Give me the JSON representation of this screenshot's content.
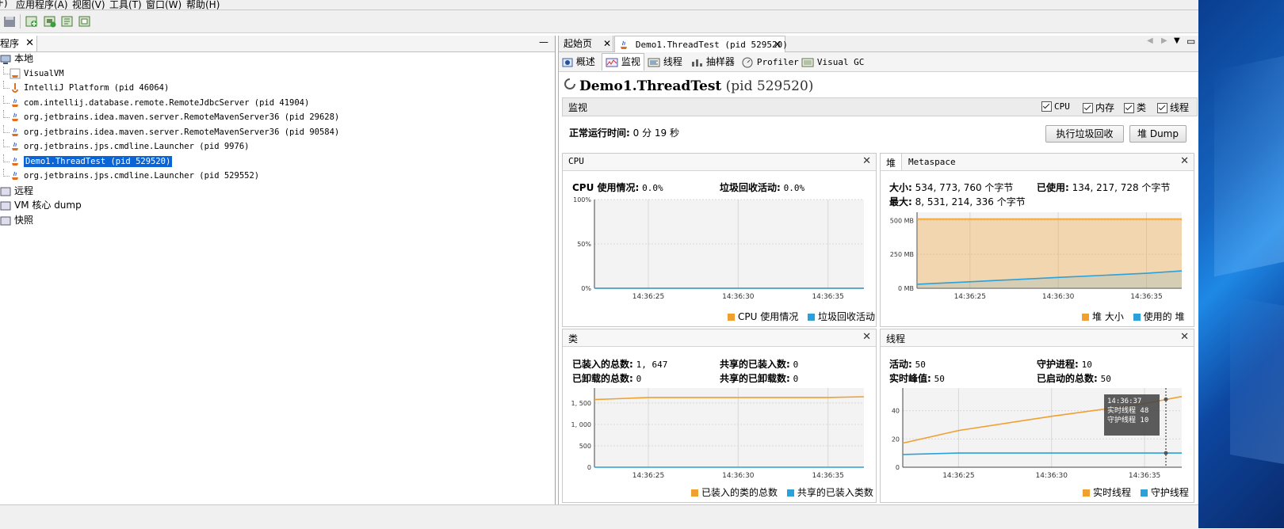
{
  "menu": [
    "F)",
    "应用程序(A)",
    "视图(V)",
    "工具(T)",
    "窗口(W)",
    "帮助(H)"
  ],
  "left": {
    "tab_label": "程序",
    "minimize": "—",
    "tree": [
      {
        "label": "本地",
        "level": 0,
        "icon": "computer-icon"
      },
      {
        "label": "VisualVM",
        "level": 1,
        "icon": "visualvm-icon"
      },
      {
        "label": "IntelliJ Platform (pid 46064)",
        "level": 1,
        "icon": "intellij-icon"
      },
      {
        "label": "com.intellij.database.remote.RemoteJdbcServer (pid 41904)",
        "level": 1,
        "icon": "java-icon"
      },
      {
        "label": "org.jetbrains.idea.maven.server.RemoteMavenServer36 (pid 29628)",
        "level": 1,
        "icon": "java-icon"
      },
      {
        "label": "org.jetbrains.idea.maven.server.RemoteMavenServer36 (pid 90584)",
        "level": 1,
        "icon": "java-icon"
      },
      {
        "label": "org.jetbrains.jps.cmdline.Launcher (pid 9976)",
        "level": 1,
        "icon": "java-icon"
      },
      {
        "label": "Demo1.ThreadTest (pid 529520)",
        "level": 1,
        "icon": "java-icon",
        "selected": true
      },
      {
        "label": "org.jetbrains.jps.cmdline.Launcher (pid 529552)",
        "level": 1,
        "icon": "java-icon"
      },
      {
        "label": "远程",
        "level": 0,
        "icon": "remote-icon"
      },
      {
        "label": "VM 核心 dump",
        "level": 0,
        "icon": "dump-icon"
      },
      {
        "label": "快照",
        "level": 0,
        "icon": "snapshot-icon"
      }
    ]
  },
  "doc_tabs": [
    {
      "label": "起始页"
    },
    {
      "label": "Demo1.ThreadTest (pid 529520)"
    }
  ],
  "sub_tabs": [
    "概述",
    "监视",
    "线程",
    "抽样器",
    "Profiler",
    "Visual GC"
  ],
  "app_title": "Demo1.ThreadTest",
  "app_pid": "(pid 529520)",
  "monitor": {
    "section_label": "监视",
    "checks": [
      "CPU",
      "内存",
      "类",
      "线程"
    ],
    "uptime_label": "正常运行时间:",
    "uptime_value": "0 分 19 秒",
    "gc_button": "执行垃圾回收",
    "heap_dump_button": "堆 Dump"
  },
  "cpu_panel": {
    "title": "CPU",
    "usage_label": "CPU 使用情况:",
    "usage_value": "0.0%",
    "gc_label": "垃圾回收活动:",
    "gc_value": "0.0%",
    "legend": [
      "CPU 使用情况",
      "垃圾回收活动"
    ]
  },
  "heap_panel": {
    "tabs": [
      "堆",
      "Metaspace"
    ],
    "size_label": "大小:",
    "size_value": "534, 773, 760 个字节",
    "used_label": "已使用:",
    "used_value": "134, 217, 728 个字节",
    "max_label": "最大:",
    "max_value": "8, 531, 214, 336 个字节",
    "legend": [
      "堆 大小",
      "使用的 堆"
    ]
  },
  "classes_panel": {
    "title": "类",
    "loaded_label": "已装入的总数:",
    "loaded_value": "1, 647",
    "unloaded_label": "已卸载的总数:",
    "unloaded_value": "0",
    "shared_loaded_label": "共享的已装入数:",
    "shared_loaded_value": "0",
    "shared_unloaded_label": "共享的已卸载数:",
    "shared_unloaded_value": "0",
    "legend": [
      "已装入的类的总数",
      "共享的已装入类数"
    ]
  },
  "threads_panel": {
    "title": "线程",
    "live_label": "活动:",
    "live_value": "50",
    "peak_label": "实时峰值:",
    "peak_value": "50",
    "daemon_label": "守护进程:",
    "daemon_value": "10",
    "started_label": "已启动的总数:",
    "started_value": "50",
    "tooltip_time": "14:36:37",
    "tooltip_live": "实时线程  48",
    "tooltip_daemon": "守护线程  10",
    "legend": [
      "实时线程",
      "守护线程"
    ]
  },
  "colors": {
    "orange": "#f0a030",
    "blue": "#2ca0d8",
    "selection": "#0a64d6"
  },
  "chart_data": [
    {
      "type": "line",
      "title": "CPU",
      "x": [
        "14:36:22",
        "14:36:25",
        "14:36:30",
        "14:36:35",
        "14:36:37"
      ],
      "xticks": [
        "14:36:25",
        "14:36:30",
        "14:36:35"
      ],
      "yticks": [
        "100%",
        "50%",
        "0%"
      ],
      "ylim": [
        0,
        100
      ],
      "series": [
        {
          "name": "CPU 使用情况",
          "values": [
            0,
            0,
            0,
            0,
            0
          ]
        },
        {
          "name": "垃圾回收活动",
          "values": [
            0,
            0,
            0,
            0,
            0
          ]
        }
      ]
    },
    {
      "type": "area",
      "title": "堆",
      "x": [
        "14:36:22",
        "14:36:25",
        "14:36:30",
        "14:36:35",
        "14:36:37"
      ],
      "xticks": [
        "14:36:25",
        "14:36:30",
        "14:36:35"
      ],
      "yticks": [
        "500 MB",
        "250 MB",
        "0 MB"
      ],
      "ylim": [
        0,
        560
      ],
      "series": [
        {
          "name": "堆 大小",
          "values": [
            510,
            510,
            510,
            510,
            510
          ]
        },
        {
          "name": "使用的 堆",
          "values": [
            30,
            48,
            80,
            110,
            128
          ]
        }
      ]
    },
    {
      "type": "line",
      "title": "类",
      "x": [
        "14:36:22",
        "14:36:25",
        "14:36:30",
        "14:36:35",
        "14:36:37"
      ],
      "xticks": [
        "14:36:25",
        "14:36:30",
        "14:36:35"
      ],
      "yticks": [
        "1, 500",
        "1, 000",
        "500",
        "0"
      ],
      "ylim": [
        0,
        1850
      ],
      "series": [
        {
          "name": "已装入的类的总数",
          "values": [
            1580,
            1630,
            1630,
            1630,
            1647
          ]
        },
        {
          "name": "共享的已装入类数",
          "values": [
            0,
            0,
            0,
            0,
            0
          ]
        }
      ]
    },
    {
      "type": "line",
      "title": "线程",
      "x": [
        "14:36:22",
        "14:36:25",
        "14:36:30",
        "14:36:35",
        "14:36:37"
      ],
      "xticks": [
        "14:36:25",
        "14:36:30",
        "14:36:35"
      ],
      "yticks": [
        "40",
        "20",
        "0"
      ],
      "ylim": [
        0,
        56
      ],
      "series": [
        {
          "name": "实时线程",
          "values": [
            17,
            26,
            36,
            45,
            50
          ]
        },
        {
          "name": "守护线程",
          "values": [
            9,
            10,
            10,
            10,
            10
          ]
        }
      ]
    }
  ]
}
